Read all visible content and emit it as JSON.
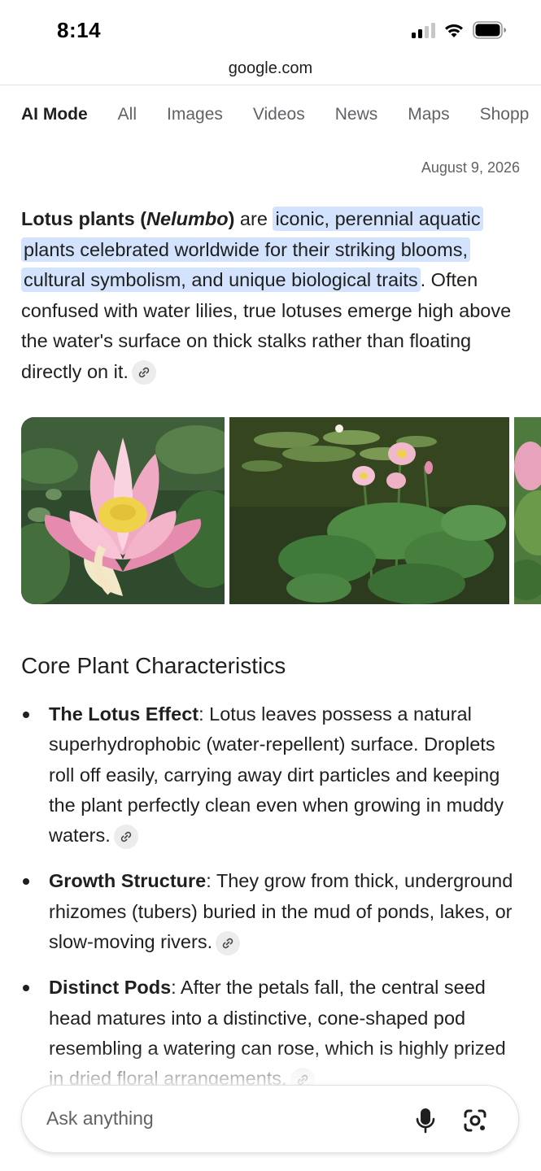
{
  "status_bar": {
    "time": "8:14"
  },
  "url_bar": {
    "domain": "google.com"
  },
  "tabs": [
    {
      "label": "AI Mode",
      "active": true
    },
    {
      "label": "All"
    },
    {
      "label": "Images"
    },
    {
      "label": "Videos"
    },
    {
      "label": "News"
    },
    {
      "label": "Maps"
    },
    {
      "label": "Shopp"
    }
  ],
  "date": "August 9, 2026",
  "intro": {
    "term": "Lotus plants (",
    "genus": "Nelumbo",
    "term_close": ")",
    "are": " are ",
    "highlight": "iconic, perennial aquatic plants celebrated worldwide for their striking blooms, cultural symbolism, and unique biological traits",
    "rest": ". Often confused with water lilies, true lotuses emerge high above the water's surface on thick stalks rather than floating directly on it."
  },
  "section": {
    "title": "Core Plant Characteristics",
    "bullets": [
      {
        "term": "The Lotus Effect",
        "text": ": Lotus leaves possess a natural superhydrophobic (water-repellent) surface. Droplets roll off easily, carrying away dirt particles and keeping the plant perfectly clean even when growing in muddy waters."
      },
      {
        "term": "Growth Structure",
        "text": ": They grow from thick, underground rhizomes (tubers) buried in the mud of ponds, lakes, or slow-moving rivers."
      },
      {
        "term": "Distinct Pods",
        "text": ": After the petals fall, the central seed head matures into a distinctive, cone-shaped pod resembling a watering can rose, which is highly prized in dried floral arrangements."
      }
    ]
  },
  "ask_bar": {
    "placeholder": "Ask anything"
  },
  "icons": {
    "link": "link-icon",
    "mic": "microphone-icon",
    "lens": "camera-lens-icon"
  },
  "colors": {
    "highlight": "#d3e3fd",
    "text": "#1f1f1f",
    "muted": "#5f6368"
  }
}
